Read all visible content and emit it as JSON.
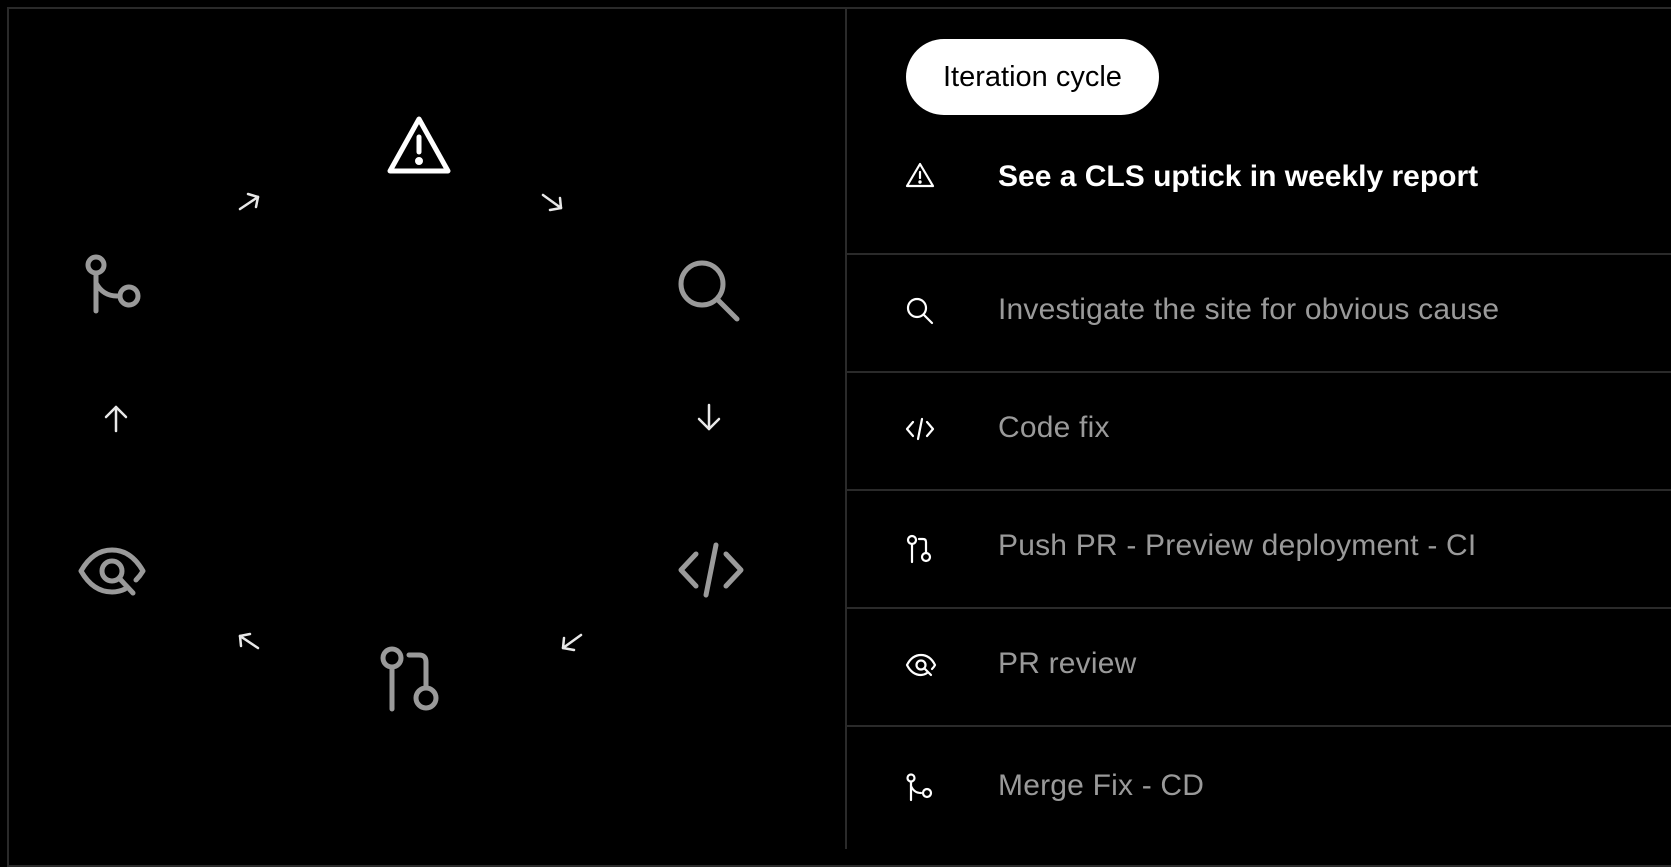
{
  "colors": {
    "background": "#000000",
    "active": "#ffffff",
    "inactive": "#9a9a9a",
    "divider": "#2a2a2a",
    "pill_bg": "#ffffff",
    "pill_text": "#000000"
  },
  "cycle_diagram": {
    "nodes": [
      {
        "icon": "warning-icon",
        "state": "active"
      },
      {
        "icon": "search-icon",
        "state": "inactive"
      },
      {
        "icon": "code-icon",
        "state": "inactive"
      },
      {
        "icon": "pull-request-icon",
        "state": "inactive"
      },
      {
        "icon": "review-eye-icon",
        "state": "inactive"
      },
      {
        "icon": "merge-icon",
        "state": "inactive"
      }
    ],
    "arrows": [
      "arrow-down-right-icon",
      "arrow-down-icon",
      "arrow-down-left-icon",
      "arrow-up-left-icon",
      "arrow-up-icon",
      "arrow-up-right-icon"
    ]
  },
  "sidebar": {
    "badge": "Iteration cycle",
    "steps": [
      {
        "label": "See a CLS uptick in weekly report",
        "icon": "warning-icon",
        "active": true
      },
      {
        "label": "Investigate the site for obvious cause",
        "icon": "search-icon",
        "active": false
      },
      {
        "label": "Code fix",
        "icon": "code-icon",
        "active": false
      },
      {
        "label": "Push PR - Preview deployment - CI",
        "icon": "pull-request-icon",
        "active": false
      },
      {
        "label": "PR review",
        "icon": "review-eye-icon",
        "active": false
      },
      {
        "label": "Merge Fix - CD",
        "icon": "merge-icon",
        "active": false
      }
    ]
  }
}
